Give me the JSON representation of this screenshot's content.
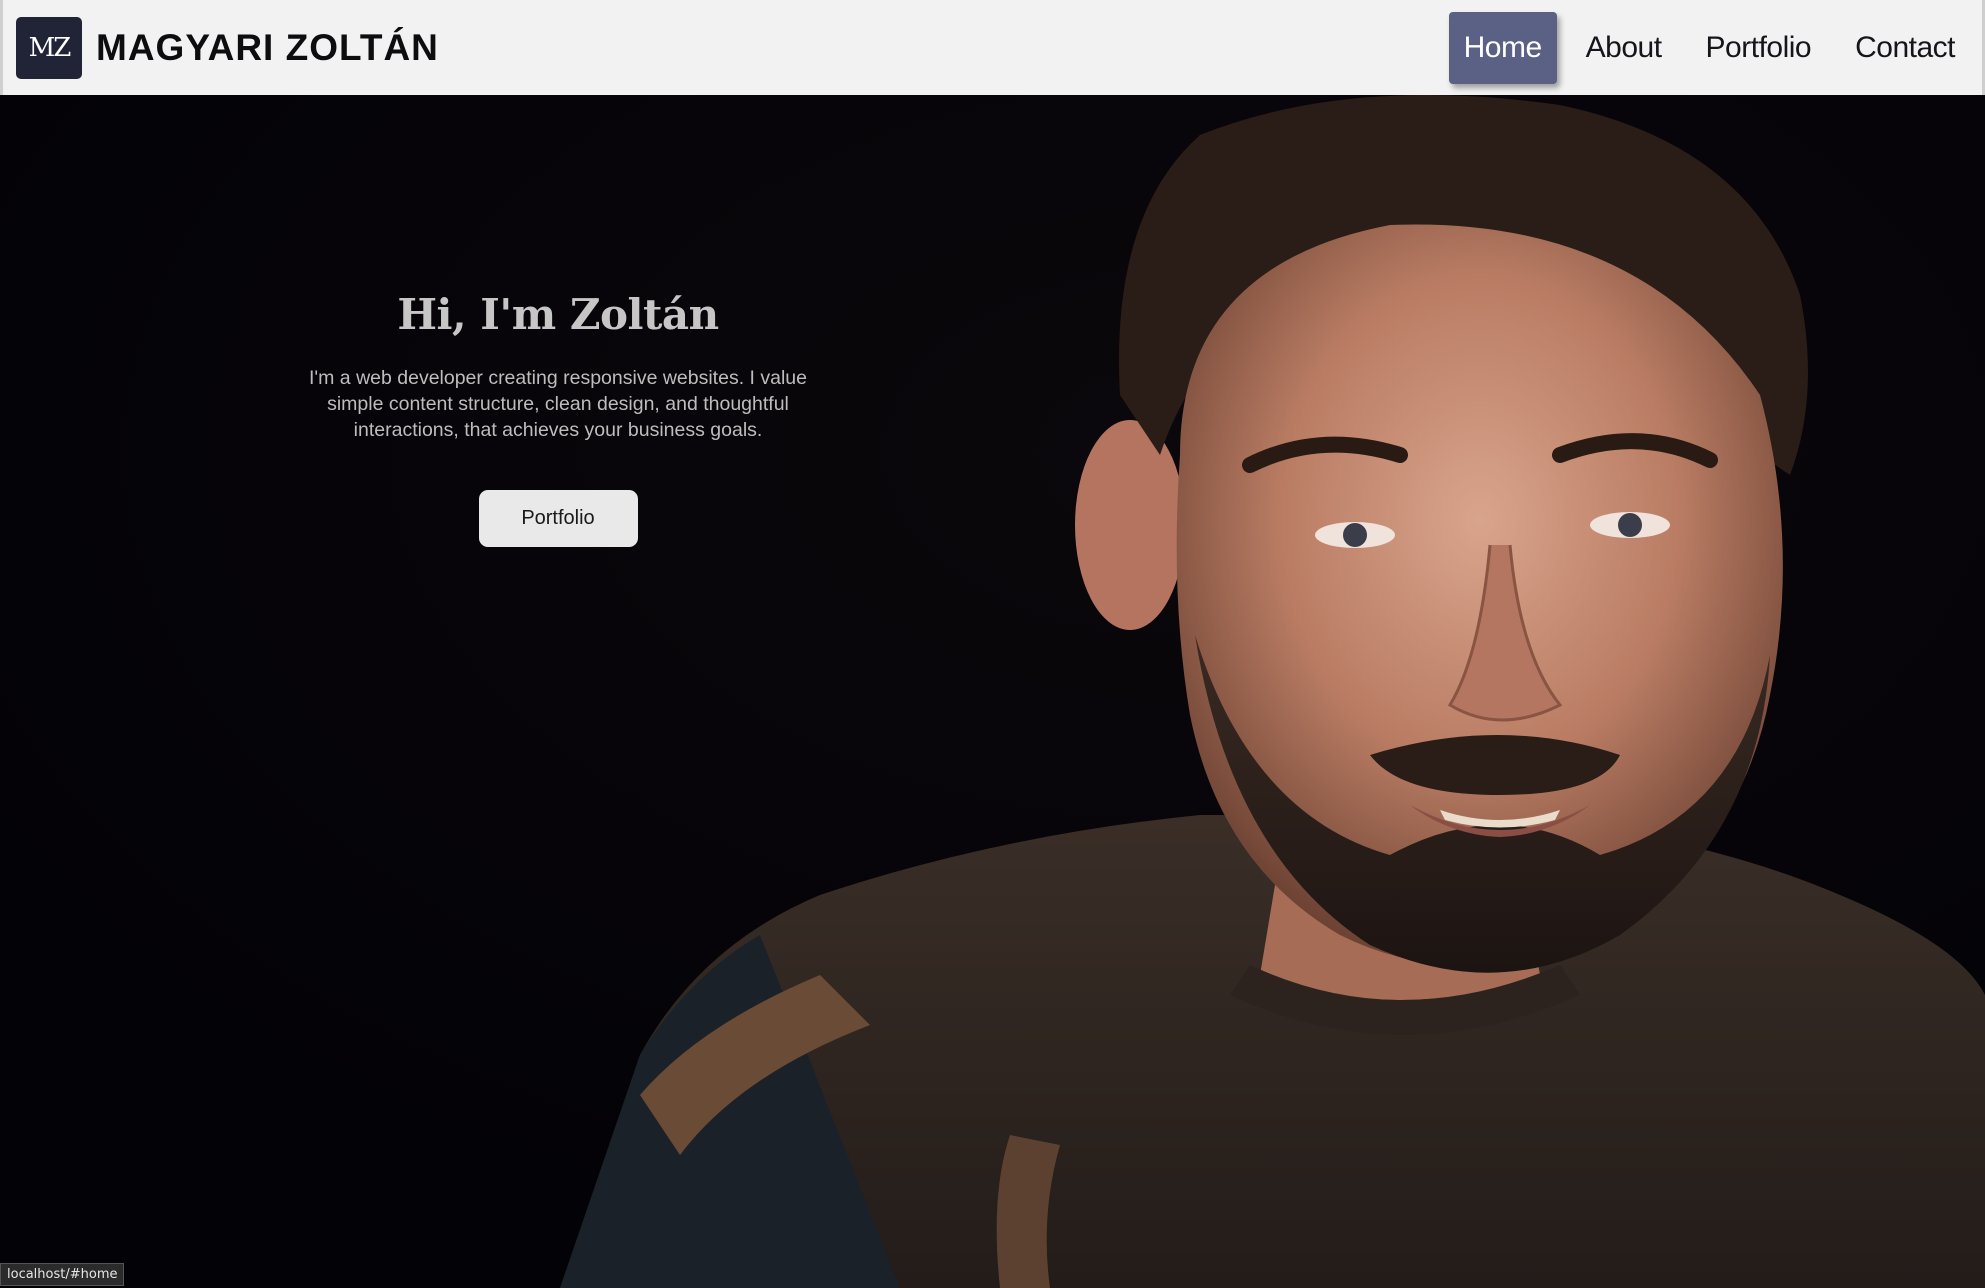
{
  "brand": {
    "logo_text": "MZ",
    "name": "MAGYARI ZOLTÁN"
  },
  "nav": {
    "items": [
      {
        "label": "Home",
        "active": true
      },
      {
        "label": "About",
        "active": false
      },
      {
        "label": "Portfolio",
        "active": false
      },
      {
        "label": "Contact",
        "active": false
      }
    ]
  },
  "hero": {
    "title": "Hi, I'm Zoltán",
    "text": "I'm a web developer creating responsive websites. I value simple content structure, clean design, and thoughtful interactions, that achieves your business goals.",
    "cta_label": "Portfolio"
  },
  "status_bar": {
    "url": "localhost/#home"
  },
  "colors": {
    "navbar_bg": "#f2f2f2",
    "logo_bg": "#212437",
    "active_nav_bg": "#5a6185",
    "hero_bg": "#040307",
    "cta_bg": "#e9e9e9"
  }
}
